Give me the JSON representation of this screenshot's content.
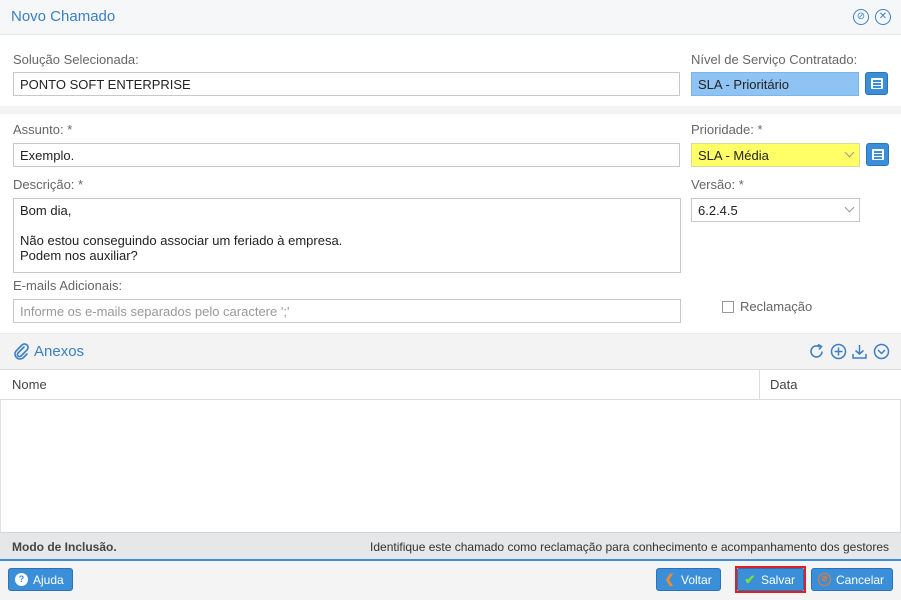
{
  "window": {
    "title": "Novo Chamado",
    "title_icons": [
      "settings-circle-icon",
      "close-circle-icon"
    ]
  },
  "form": {
    "solucao": {
      "label": "Solução Selecionada:",
      "value": "PONTO SOFT ENTERPRISE"
    },
    "nivel": {
      "label": "Nível de Serviço Contratado:",
      "value": "SLA - Prioritário"
    },
    "assunto": {
      "label": "Assunto: *",
      "value": "Exemplo."
    },
    "prioridade": {
      "label": "Prioridade: *",
      "value": "SLA - Média"
    },
    "descricao": {
      "label": "Descrição: *",
      "value": "Bom dia,\n\nNão estou conseguindo associar um feriado à empresa.\nPodem nos auxiliar?"
    },
    "versao": {
      "label": "Versão: *",
      "value": "6.2.4.5"
    },
    "emails": {
      "label": "E-mails Adicionais:",
      "placeholder": "Informe os e-mails separados pelo caractere ';'"
    },
    "reclamacao": {
      "label": "Reclamação",
      "checked": false
    }
  },
  "anexos": {
    "title": "Anexos",
    "columns": [
      "Nome",
      "Data"
    ],
    "rows": [],
    "tools": [
      "refresh-icon",
      "add-icon",
      "download-icon",
      "collapse-icon"
    ]
  },
  "status": {
    "mode_label": "Modo de Inclusão.",
    "hint": "Identifique este chamado como reclamação para conhecimento e acompanhamento dos gestores"
  },
  "footer": {
    "help_label": "Ajuda",
    "back_label": "Voltar",
    "save_label": "Salvar",
    "cancel_label": "Cancelar"
  },
  "colors": {
    "accent": "#3b8fd8",
    "title": "#3b7fc4",
    "sla_highlight": "#8ec3f3",
    "priority_highlight": "#ffff66",
    "save_outline": "#e02020"
  }
}
